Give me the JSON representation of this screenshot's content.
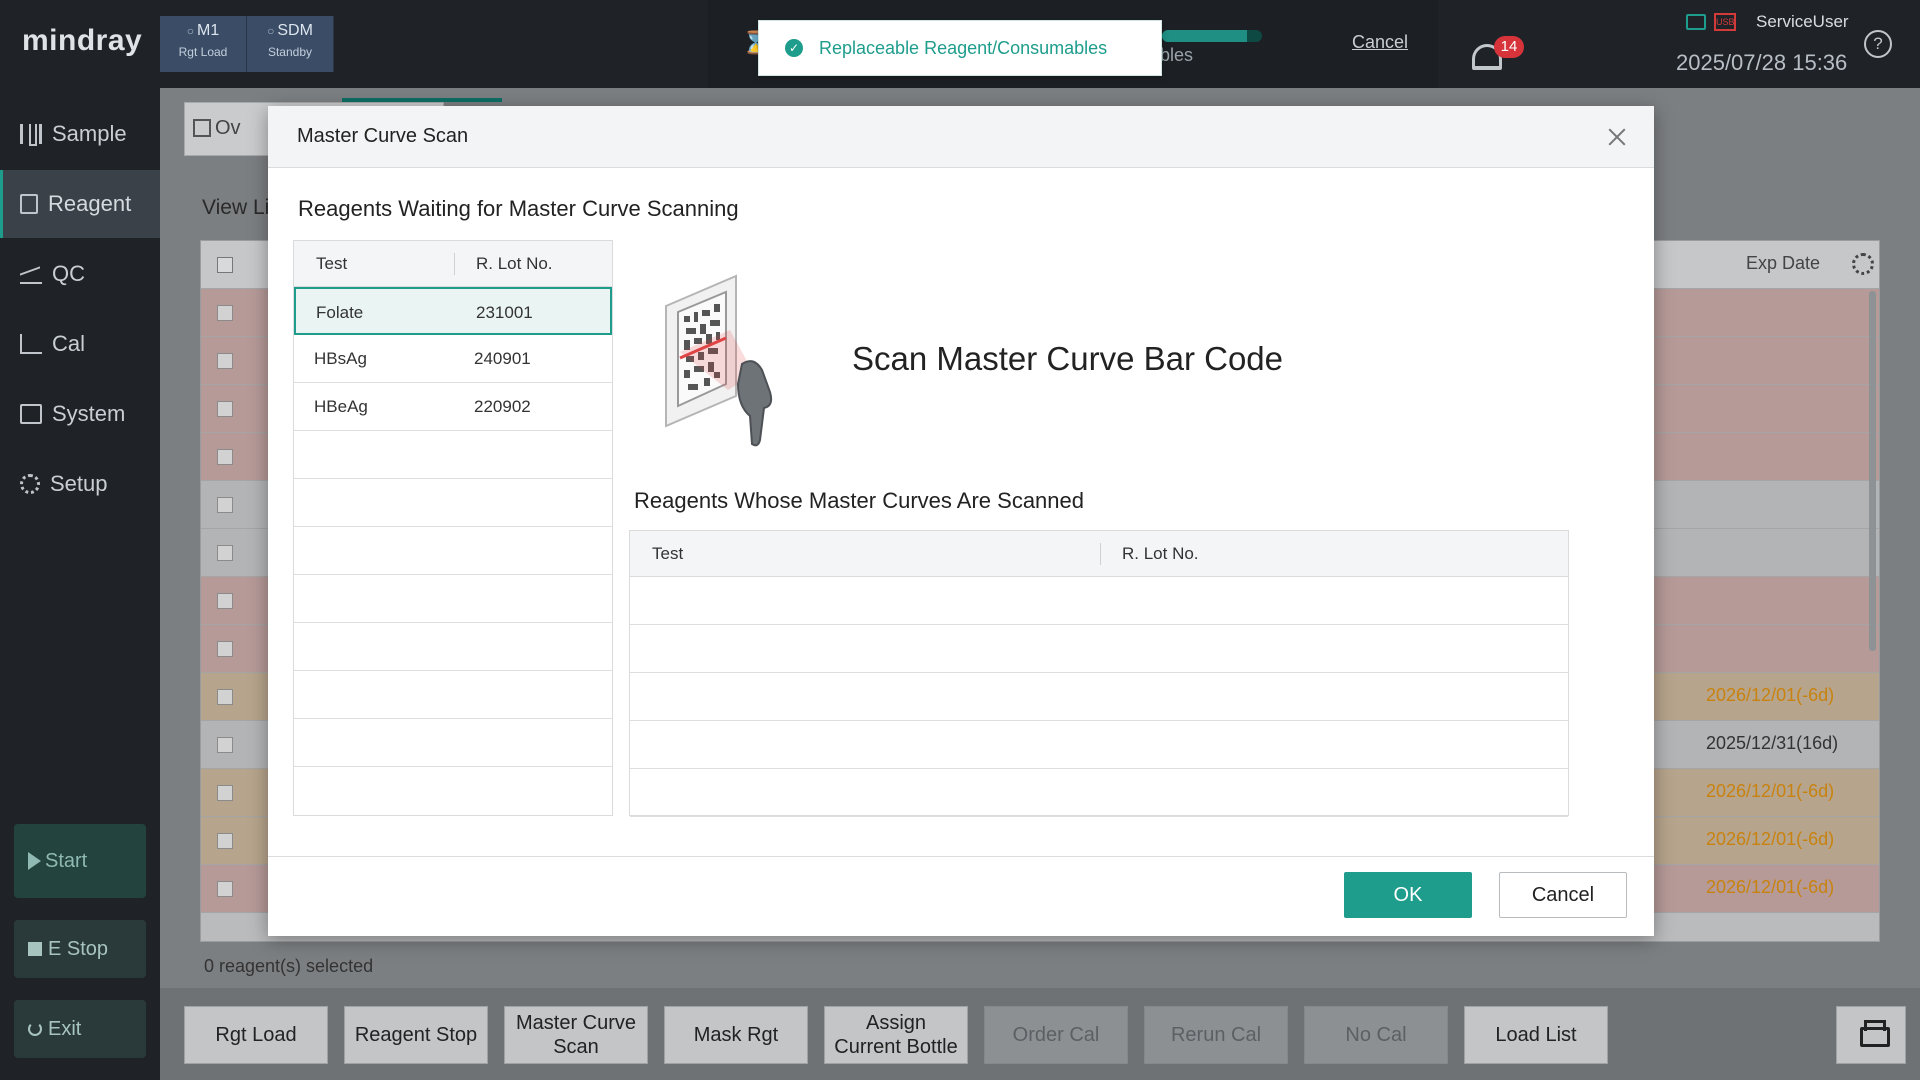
{
  "app": {
    "logo": "mindray",
    "modules": [
      {
        "name": "M1",
        "state": "Rgt Load"
      },
      {
        "name": "SDM",
        "state": "Standby"
      }
    ],
    "status_text": "bles",
    "progress_fraction": 0.85,
    "cancel_label": "Cancel",
    "alarm_count": "14",
    "usb_label": "USB",
    "user": "ServiceUser",
    "datetime": "2025/07/28 15:36",
    "help_label": "?"
  },
  "sidebar": {
    "items": [
      {
        "label": "Sample",
        "icon": "sample-icon"
      },
      {
        "label": "Reagent",
        "icon": "reagent-icon",
        "active": true
      },
      {
        "label": "QC",
        "icon": "qc-icon"
      },
      {
        "label": "Cal",
        "icon": "cal-icon"
      },
      {
        "label": "System",
        "icon": "system-icon"
      },
      {
        "label": "Setup",
        "icon": "gear-icon"
      }
    ],
    "start_label": "Start",
    "estop_label": "E Stop",
    "exit_label": "Exit"
  },
  "background": {
    "tab_label": "Ov",
    "view_list_label": "View Li",
    "exp_date_header": "Exp Date",
    "rows": [
      {
        "exp": "",
        "tone": "red"
      },
      {
        "exp": "",
        "tone": "red"
      },
      {
        "exp": "",
        "tone": "red"
      },
      {
        "exp": "",
        "tone": "red"
      },
      {
        "exp": "",
        "tone": "grey"
      },
      {
        "exp": "",
        "tone": "grey"
      },
      {
        "exp": "",
        "tone": "red"
      },
      {
        "exp": "",
        "tone": "red"
      },
      {
        "exp": "2026/12/01(-6d)",
        "tone": "orange"
      },
      {
        "exp": "2025/12/31(16d)",
        "tone": "grey"
      },
      {
        "exp": "2026/12/01(-6d)",
        "tone": "orange"
      },
      {
        "exp": "2026/12/01(-6d)",
        "tone": "orange"
      },
      {
        "exp": "2026/12/01(-6d)",
        "tone": "red"
      }
    ],
    "selected_count": "0 reagent(s) selected",
    "buttons": [
      {
        "label": "Rgt Load",
        "disabled": false
      },
      {
        "label": "Reagent Stop",
        "disabled": false
      },
      {
        "label": "Master Curve Scan",
        "disabled": false
      },
      {
        "label": "Mask  Rgt",
        "disabled": false
      },
      {
        "label": "Assign Current Bottle",
        "disabled": false
      },
      {
        "label": "Order Cal",
        "disabled": true
      },
      {
        "label": "Rerun Cal",
        "disabled": true
      },
      {
        "label": "No Cal",
        "disabled": true
      },
      {
        "label": "Load List",
        "disabled": false
      }
    ]
  },
  "toast": {
    "text": "Replaceable Reagent/Consumables"
  },
  "modal": {
    "title": "Master Curve Scan",
    "waiting_title": "Reagents Waiting for Master Curve Scanning",
    "waiting_columns": [
      "Test",
      "R. Lot No."
    ],
    "waiting_rows": [
      {
        "test": "Folate",
        "lot": "231001",
        "selected": true
      },
      {
        "test": "HBsAg",
        "lot": "240901",
        "selected": false
      },
      {
        "test": "HBeAg",
        "lot": "220902",
        "selected": false
      }
    ],
    "waiting_empty_rows": 7,
    "scan_heading": "Scan Master Curve Bar Code",
    "scanned_title": "Reagents Whose Master Curves Are Scanned",
    "scanned_columns": [
      "Test",
      "R. Lot No."
    ],
    "scanned_empty_rows": 5,
    "ok_label": "OK",
    "cancel_label": "Cancel"
  },
  "colors": {
    "accent": "#1e9d8c",
    "alarm": "#d6343a",
    "row_red": "#b69a98",
    "row_orange": "#b7a48c",
    "expire_text": "#c8820e"
  }
}
